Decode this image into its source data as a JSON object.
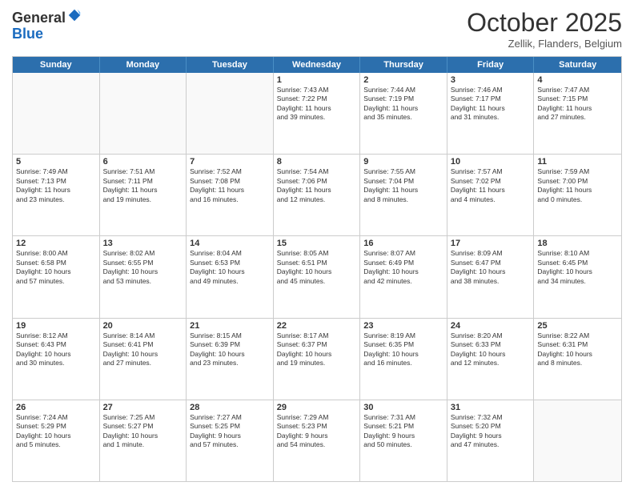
{
  "header": {
    "logo": {
      "line1": "General",
      "line2": "Blue"
    },
    "title": "October 2025",
    "location": "Zellik, Flanders, Belgium"
  },
  "days_of_week": [
    "Sunday",
    "Monday",
    "Tuesday",
    "Wednesday",
    "Thursday",
    "Friday",
    "Saturday"
  ],
  "weeks": [
    [
      {
        "day": "",
        "empty": true
      },
      {
        "day": "",
        "empty": true
      },
      {
        "day": "",
        "empty": true
      },
      {
        "day": "1",
        "text": "Sunrise: 7:43 AM\nSunset: 7:22 PM\nDaylight: 11 hours\nand 39 minutes."
      },
      {
        "day": "2",
        "text": "Sunrise: 7:44 AM\nSunset: 7:19 PM\nDaylight: 11 hours\nand 35 minutes."
      },
      {
        "day": "3",
        "text": "Sunrise: 7:46 AM\nSunset: 7:17 PM\nDaylight: 11 hours\nand 31 minutes."
      },
      {
        "day": "4",
        "text": "Sunrise: 7:47 AM\nSunset: 7:15 PM\nDaylight: 11 hours\nand 27 minutes."
      }
    ],
    [
      {
        "day": "5",
        "text": "Sunrise: 7:49 AM\nSunset: 7:13 PM\nDaylight: 11 hours\nand 23 minutes."
      },
      {
        "day": "6",
        "text": "Sunrise: 7:51 AM\nSunset: 7:11 PM\nDaylight: 11 hours\nand 19 minutes."
      },
      {
        "day": "7",
        "text": "Sunrise: 7:52 AM\nSunset: 7:08 PM\nDaylight: 11 hours\nand 16 minutes."
      },
      {
        "day": "8",
        "text": "Sunrise: 7:54 AM\nSunset: 7:06 PM\nDaylight: 11 hours\nand 12 minutes."
      },
      {
        "day": "9",
        "text": "Sunrise: 7:55 AM\nSunset: 7:04 PM\nDaylight: 11 hours\nand 8 minutes."
      },
      {
        "day": "10",
        "text": "Sunrise: 7:57 AM\nSunset: 7:02 PM\nDaylight: 11 hours\nand 4 minutes."
      },
      {
        "day": "11",
        "text": "Sunrise: 7:59 AM\nSunset: 7:00 PM\nDaylight: 11 hours\nand 0 minutes."
      }
    ],
    [
      {
        "day": "12",
        "text": "Sunrise: 8:00 AM\nSunset: 6:58 PM\nDaylight: 10 hours\nand 57 minutes."
      },
      {
        "day": "13",
        "text": "Sunrise: 8:02 AM\nSunset: 6:55 PM\nDaylight: 10 hours\nand 53 minutes."
      },
      {
        "day": "14",
        "text": "Sunrise: 8:04 AM\nSunset: 6:53 PM\nDaylight: 10 hours\nand 49 minutes."
      },
      {
        "day": "15",
        "text": "Sunrise: 8:05 AM\nSunset: 6:51 PM\nDaylight: 10 hours\nand 45 minutes."
      },
      {
        "day": "16",
        "text": "Sunrise: 8:07 AM\nSunset: 6:49 PM\nDaylight: 10 hours\nand 42 minutes."
      },
      {
        "day": "17",
        "text": "Sunrise: 8:09 AM\nSunset: 6:47 PM\nDaylight: 10 hours\nand 38 minutes."
      },
      {
        "day": "18",
        "text": "Sunrise: 8:10 AM\nSunset: 6:45 PM\nDaylight: 10 hours\nand 34 minutes."
      }
    ],
    [
      {
        "day": "19",
        "text": "Sunrise: 8:12 AM\nSunset: 6:43 PM\nDaylight: 10 hours\nand 30 minutes."
      },
      {
        "day": "20",
        "text": "Sunrise: 8:14 AM\nSunset: 6:41 PM\nDaylight: 10 hours\nand 27 minutes."
      },
      {
        "day": "21",
        "text": "Sunrise: 8:15 AM\nSunset: 6:39 PM\nDaylight: 10 hours\nand 23 minutes."
      },
      {
        "day": "22",
        "text": "Sunrise: 8:17 AM\nSunset: 6:37 PM\nDaylight: 10 hours\nand 19 minutes."
      },
      {
        "day": "23",
        "text": "Sunrise: 8:19 AM\nSunset: 6:35 PM\nDaylight: 10 hours\nand 16 minutes."
      },
      {
        "day": "24",
        "text": "Sunrise: 8:20 AM\nSunset: 6:33 PM\nDaylight: 10 hours\nand 12 minutes."
      },
      {
        "day": "25",
        "text": "Sunrise: 8:22 AM\nSunset: 6:31 PM\nDaylight: 10 hours\nand 8 minutes."
      }
    ],
    [
      {
        "day": "26",
        "text": "Sunrise: 7:24 AM\nSunset: 5:29 PM\nDaylight: 10 hours\nand 5 minutes."
      },
      {
        "day": "27",
        "text": "Sunrise: 7:25 AM\nSunset: 5:27 PM\nDaylight: 10 hours\nand 1 minute."
      },
      {
        "day": "28",
        "text": "Sunrise: 7:27 AM\nSunset: 5:25 PM\nDaylight: 9 hours\nand 57 minutes."
      },
      {
        "day": "29",
        "text": "Sunrise: 7:29 AM\nSunset: 5:23 PM\nDaylight: 9 hours\nand 54 minutes."
      },
      {
        "day": "30",
        "text": "Sunrise: 7:31 AM\nSunset: 5:21 PM\nDaylight: 9 hours\nand 50 minutes."
      },
      {
        "day": "31",
        "text": "Sunrise: 7:32 AM\nSunset: 5:20 PM\nDaylight: 9 hours\nand 47 minutes."
      },
      {
        "day": "",
        "empty": true
      }
    ]
  ]
}
